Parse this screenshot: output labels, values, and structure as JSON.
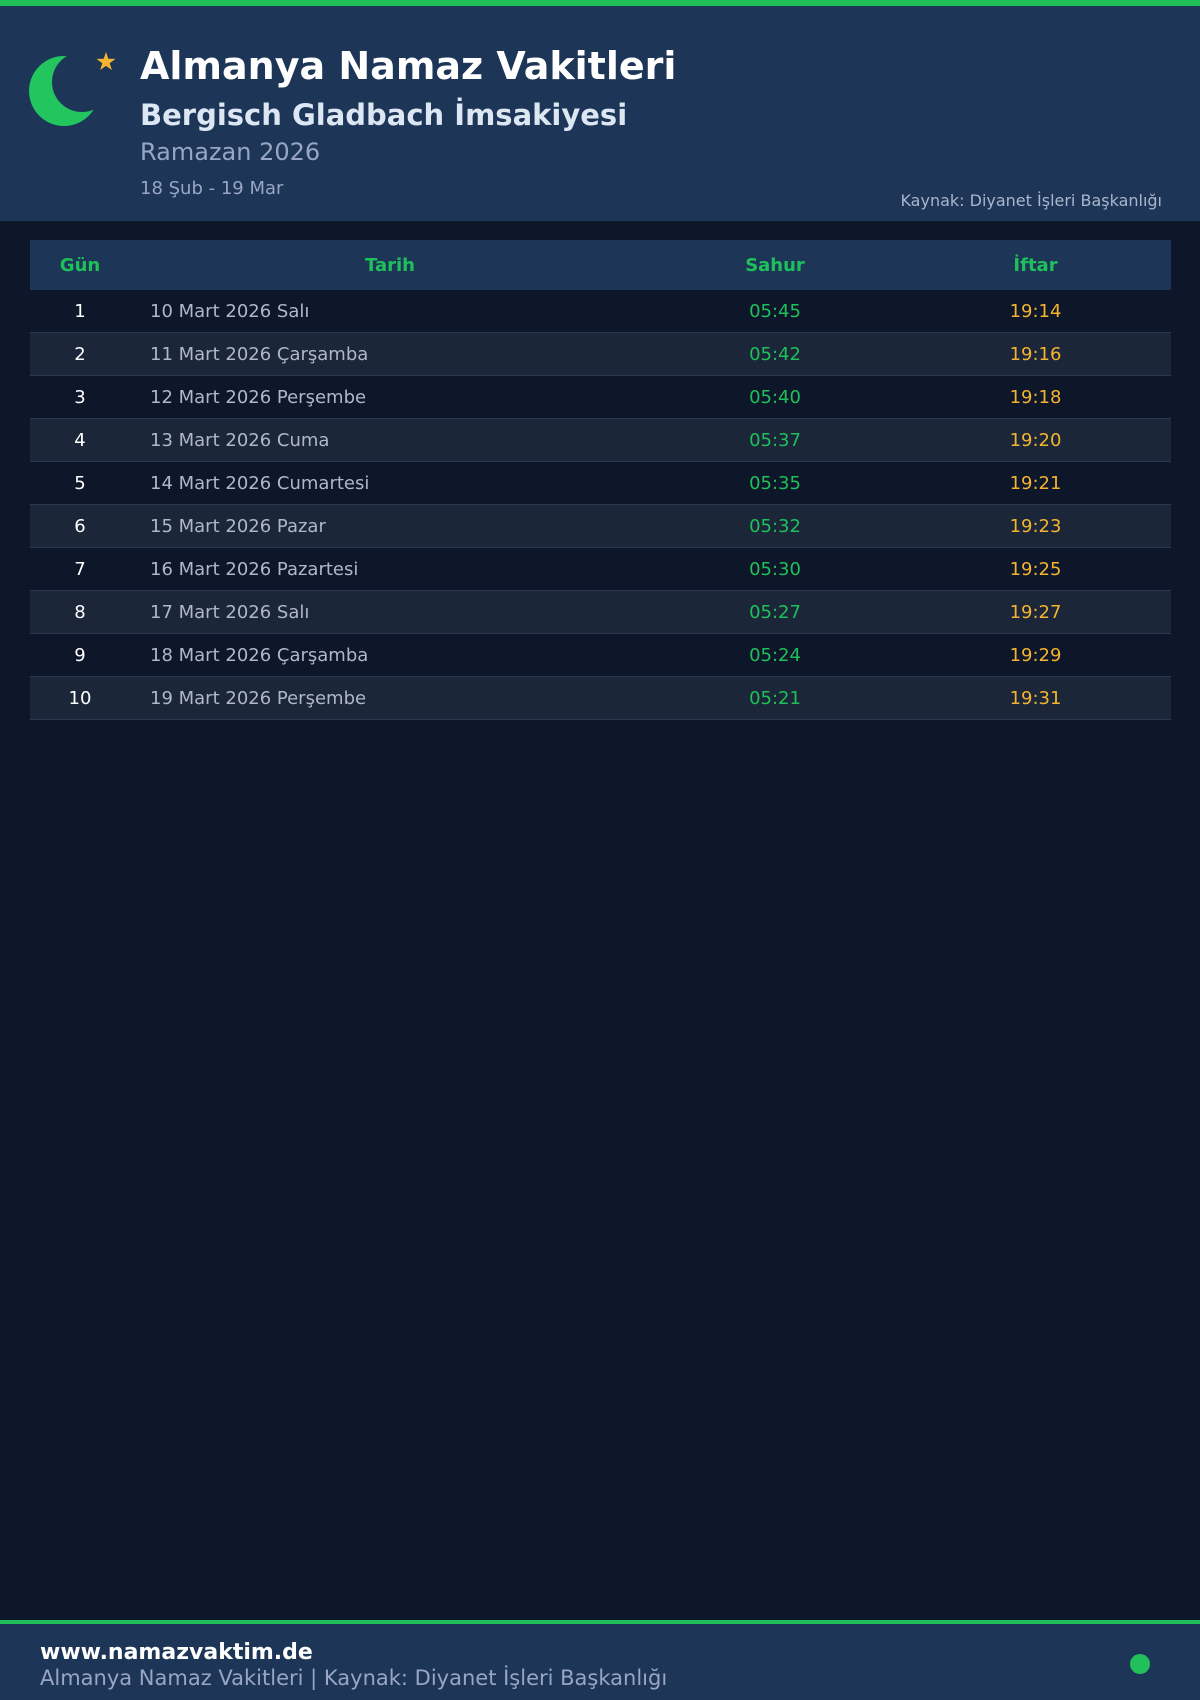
{
  "header": {
    "title": "Almanya Namaz Vakitleri",
    "subtitle": "Bergisch Gladbach İmsakiyesi",
    "ramadan": "Ramazan 2026",
    "range": "18 Şub - 19 Mar",
    "source": "Kaynak: Diyanet İşleri Başkanlığı",
    "icons": [
      "crescent-icon",
      "star-icon"
    ]
  },
  "table": {
    "headers": {
      "day": "Gün",
      "date": "Tarih",
      "sahur": "Sahur",
      "iftar": "İftar"
    },
    "rows": [
      {
        "day": "1",
        "date": "10 Mart 2026 Salı",
        "sahur": "05:45",
        "iftar": "19:14"
      },
      {
        "day": "2",
        "date": "11 Mart 2026 Çarşamba",
        "sahur": "05:42",
        "iftar": "19:16"
      },
      {
        "day": "3",
        "date": "12 Mart 2026 Perşembe",
        "sahur": "05:40",
        "iftar": "19:18"
      },
      {
        "day": "4",
        "date": "13 Mart 2026 Cuma",
        "sahur": "05:37",
        "iftar": "19:20"
      },
      {
        "day": "5",
        "date": "14 Mart 2026 Cumartesi",
        "sahur": "05:35",
        "iftar": "19:21"
      },
      {
        "day": "6",
        "date": "15 Mart 2026 Pazar",
        "sahur": "05:32",
        "iftar": "19:23"
      },
      {
        "day": "7",
        "date": "16 Mart 2026 Pazartesi",
        "sahur": "05:30",
        "iftar": "19:25"
      },
      {
        "day": "8",
        "date": "17 Mart 2026 Salı",
        "sahur": "05:27",
        "iftar": "19:27"
      },
      {
        "day": "9",
        "date": "18 Mart 2026 Çarşamba",
        "sahur": "05:24",
        "iftar": "19:29"
      },
      {
        "day": "10",
        "date": "19 Mart 2026 Perşembe",
        "sahur": "05:21",
        "iftar": "19:31"
      }
    ]
  },
  "footer": {
    "site": "www.namazvaktim.de",
    "text": "Almanya Namaz Vakitleri | Kaynak: Diyanet İşleri Başkanlığı"
  },
  "colors": {
    "accent_green": "#1fc05a",
    "accent_gold": "#f4b430",
    "header_bg": "#1d3557",
    "page_bg": "#0e1629"
  }
}
